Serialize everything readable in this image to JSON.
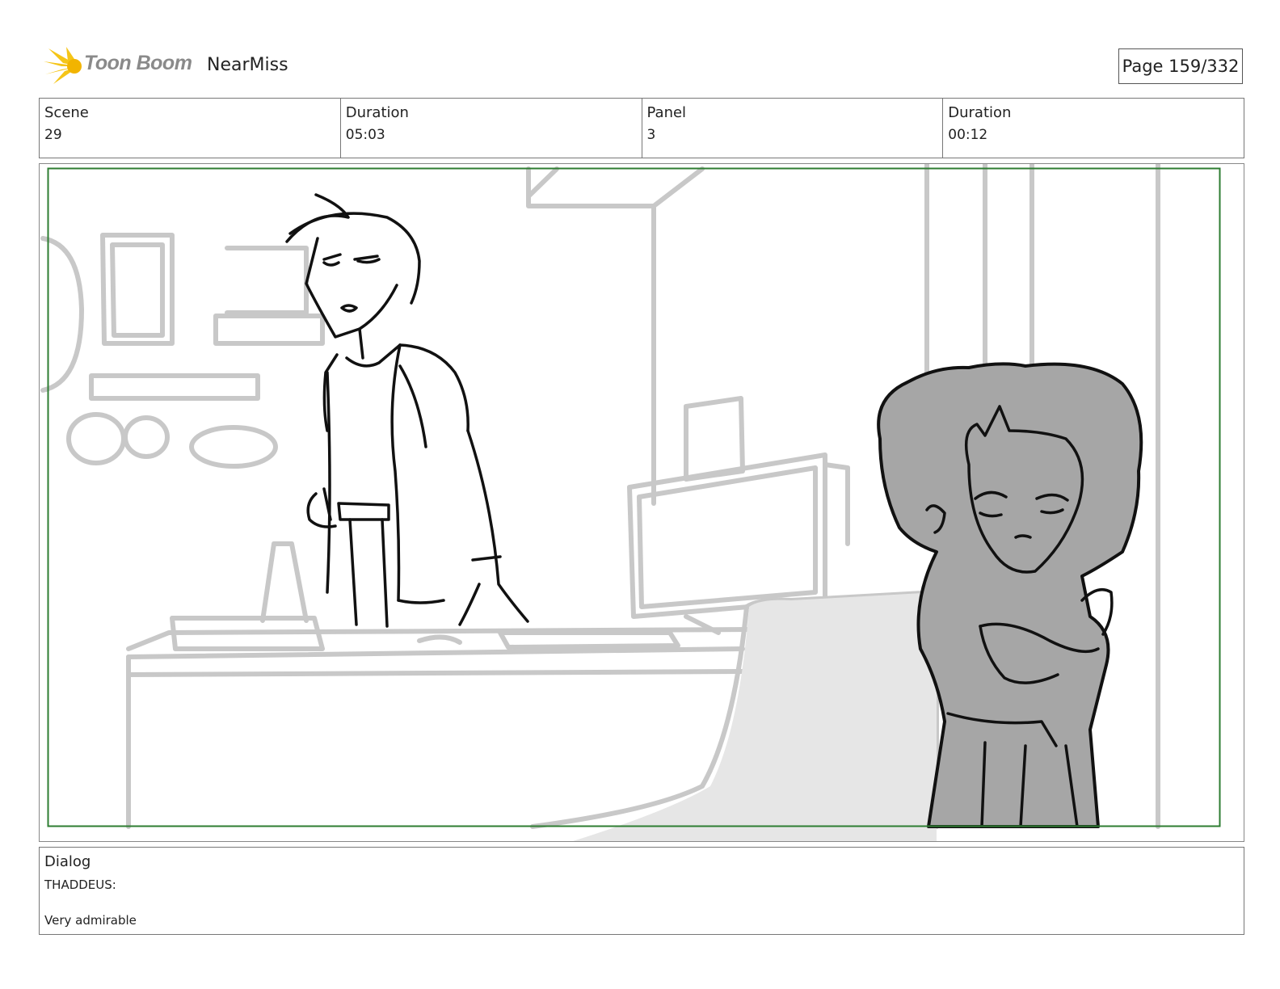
{
  "header": {
    "logo_text": "Toon Boom",
    "project_title": "NearMiss",
    "page_label": "Page 159/332"
  },
  "info": {
    "scene_label": "Scene",
    "scene_value": "29",
    "scene_duration_label": "Duration",
    "scene_duration_value": "05:03",
    "panel_label": "Panel",
    "panel_value": "3",
    "panel_duration_label": "Duration",
    "panel_duration_value": "00:12"
  },
  "dialog": {
    "heading": "Dialog",
    "speaker": "THADDEUS:",
    "line": "Very admirable"
  },
  "colors": {
    "safe_frame": "#2e7d32",
    "logo_yellow": "#f5c518",
    "sketch_gray": "#c8c8c8",
    "character_fill": "#a6a6a6"
  }
}
